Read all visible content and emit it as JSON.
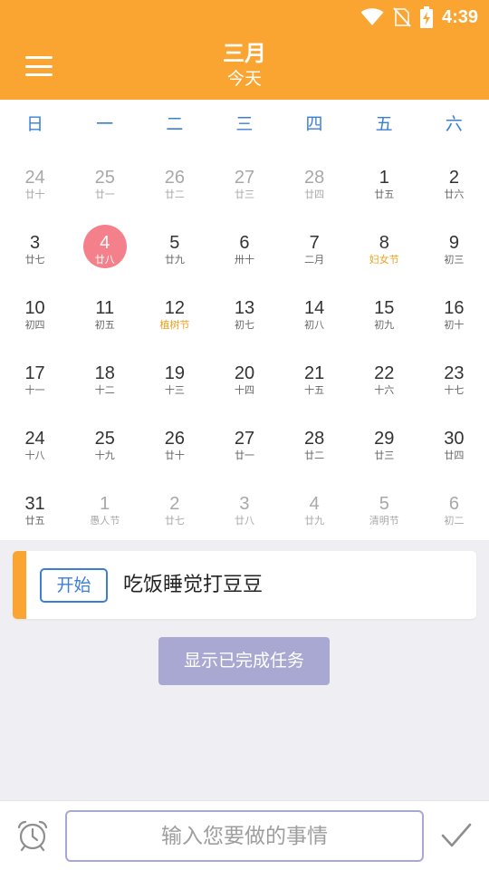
{
  "status": {
    "time": "4:39"
  },
  "header": {
    "title": "三月",
    "subtitle": "今天"
  },
  "weekdays": [
    "日",
    "一",
    "二",
    "三",
    "四",
    "五",
    "六"
  ],
  "days": [
    {
      "n": "24",
      "l": "廿十",
      "other": true
    },
    {
      "n": "25",
      "l": "廿一",
      "other": true
    },
    {
      "n": "26",
      "l": "廿二",
      "other": true
    },
    {
      "n": "27",
      "l": "廿三",
      "other": true
    },
    {
      "n": "28",
      "l": "廿四",
      "other": true
    },
    {
      "n": "1",
      "l": "廿五"
    },
    {
      "n": "2",
      "l": "廿六"
    },
    {
      "n": "3",
      "l": "廿七"
    },
    {
      "n": "4",
      "l": "廿八",
      "today": true
    },
    {
      "n": "5",
      "l": "廿九"
    },
    {
      "n": "6",
      "l": "卅十"
    },
    {
      "n": "7",
      "l": "二月"
    },
    {
      "n": "8",
      "l": "妇女节",
      "festival": true
    },
    {
      "n": "9",
      "l": "初三"
    },
    {
      "n": "10",
      "l": "初四"
    },
    {
      "n": "11",
      "l": "初五"
    },
    {
      "n": "12",
      "l": "植树节",
      "festival": true
    },
    {
      "n": "13",
      "l": "初七"
    },
    {
      "n": "14",
      "l": "初八"
    },
    {
      "n": "15",
      "l": "初九"
    },
    {
      "n": "16",
      "l": "初十"
    },
    {
      "n": "17",
      "l": "十一"
    },
    {
      "n": "18",
      "l": "十二"
    },
    {
      "n": "19",
      "l": "十三"
    },
    {
      "n": "20",
      "l": "十四"
    },
    {
      "n": "21",
      "l": "十五"
    },
    {
      "n": "22",
      "l": "十六"
    },
    {
      "n": "23",
      "l": "十七"
    },
    {
      "n": "24",
      "l": "十八"
    },
    {
      "n": "25",
      "l": "十九"
    },
    {
      "n": "26",
      "l": "廿十"
    },
    {
      "n": "27",
      "l": "廿一"
    },
    {
      "n": "28",
      "l": "廿二"
    },
    {
      "n": "29",
      "l": "廿三"
    },
    {
      "n": "30",
      "l": "廿四"
    },
    {
      "n": "31",
      "l": "廿五"
    },
    {
      "n": "1",
      "l": "愚人节",
      "other": true
    },
    {
      "n": "2",
      "l": "廿七",
      "other": true
    },
    {
      "n": "3",
      "l": "廿八",
      "other": true
    },
    {
      "n": "4",
      "l": "廿九",
      "other": true
    },
    {
      "n": "5",
      "l": "清明节",
      "other": true
    },
    {
      "n": "6",
      "l": "初二",
      "other": true
    }
  ],
  "task": {
    "start_label": "开始",
    "text": "吃饭睡觉打豆豆"
  },
  "show_done_label": "显示已完成任务",
  "input": {
    "placeholder": "输入您要做的事情",
    "value": ""
  },
  "icons": {
    "alarm": "alarm-clock-icon",
    "confirm": "check-icon",
    "menu": "menu-icon"
  },
  "colors": {
    "accent": "#faa532",
    "blue": "#3b7fd4",
    "today": "#f4808c",
    "button": "#a9a8d3"
  }
}
